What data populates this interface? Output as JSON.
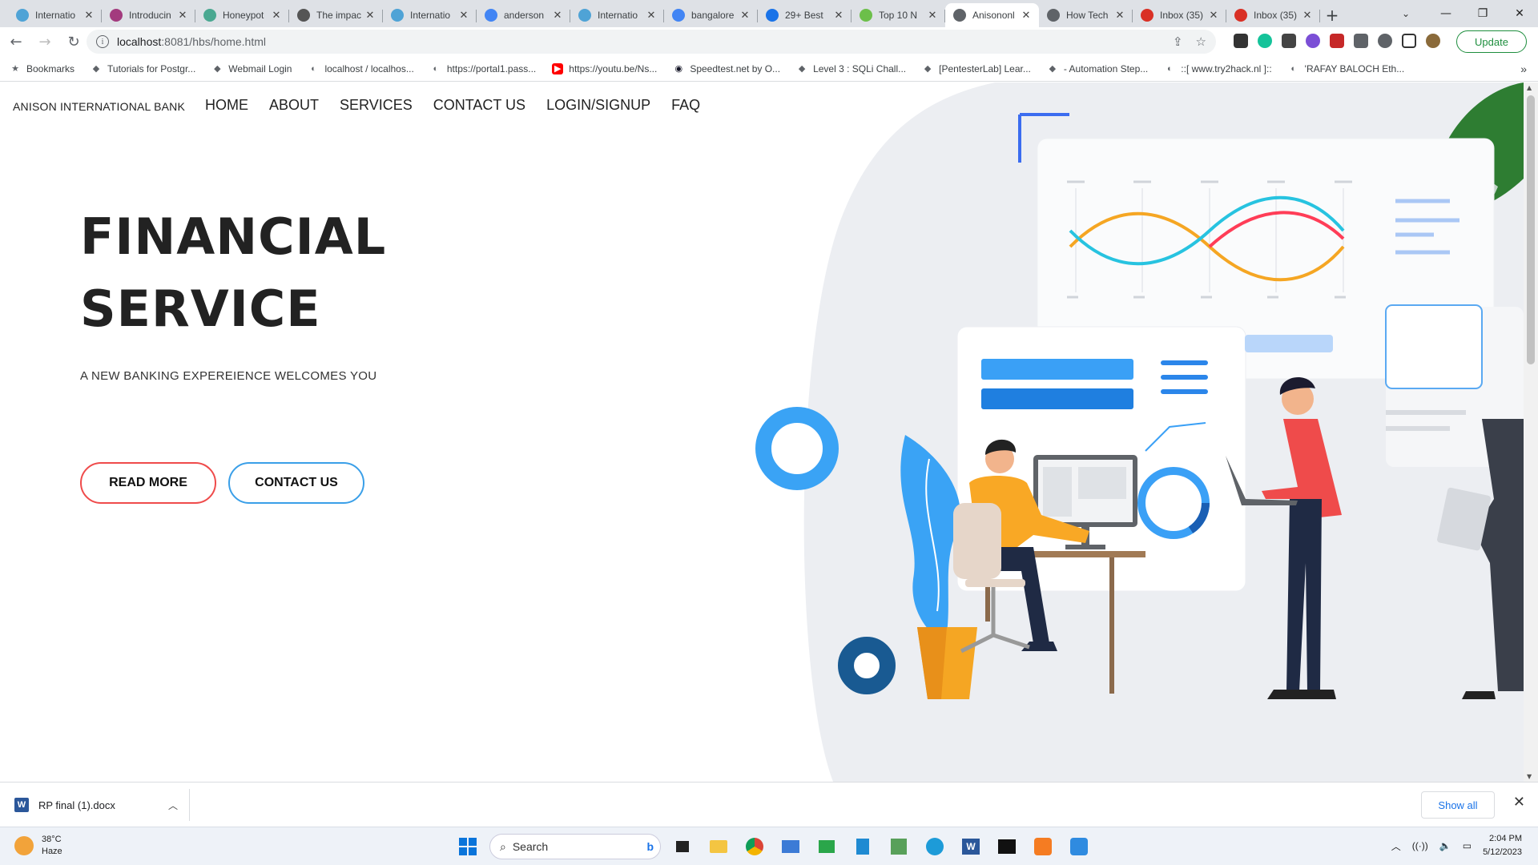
{
  "browser": {
    "tabs": [
      {
        "title": "Internatio",
        "color": "#4fa3d6"
      },
      {
        "title": "Introducin",
        "color": "#a33b7e"
      },
      {
        "title": "Honeypot",
        "color": "#4aa891"
      },
      {
        "title": "The impac",
        "color": "#555555"
      },
      {
        "title": "Internatio",
        "color": "#4fa3d6"
      },
      {
        "title": "anderson",
        "color": "#4285f4"
      },
      {
        "title": "Internatio",
        "color": "#4fa3d6"
      },
      {
        "title": "bangalore",
        "color": "#4285f4"
      },
      {
        "title": "29+ Best",
        "color": "#1a73e8"
      },
      {
        "title": "Top 10 N",
        "color": "#6cbf4a"
      },
      {
        "title": "Anisononl",
        "color": "#5f6368",
        "active": true
      },
      {
        "title": "How Tech",
        "color": "#5f6368"
      },
      {
        "title": "Inbox (35)",
        "color": "#d93025"
      },
      {
        "title": "Inbox (35)",
        "color": "#d93025"
      }
    ],
    "new_tab": "+",
    "close_glyph": "✕",
    "address": {
      "host": "localhost",
      "rest": ":8081/hbs/home.html"
    },
    "update_label": "Update",
    "bookmarks": [
      {
        "label": "Bookmarks",
        "icon": "star-icon"
      },
      {
        "label": "Tutorials for Postgr...",
        "icon": "site-icon"
      },
      {
        "label": "Webmail Login",
        "icon": "site-icon"
      },
      {
        "label": "localhost / localhos...",
        "icon": "globe-icon"
      },
      {
        "label": "https://portal1.pass...",
        "icon": "globe-icon"
      },
      {
        "label": "https://youtu.be/Ns...",
        "icon": "youtube-icon"
      },
      {
        "label": "Speedtest.net by O...",
        "icon": "speedtest-icon"
      },
      {
        "label": "Level 3 : SQLi Chall...",
        "icon": "site-icon"
      },
      {
        "label": "[PentesterLab] Lear...",
        "icon": "site-icon"
      },
      {
        "label": "- Automation Step...",
        "icon": "site-icon"
      },
      {
        "label": "::[ www.try2hack.nl ]::",
        "icon": "globe-icon"
      },
      {
        "label": "'RAFAY BALOCH Eth...",
        "icon": "globe-icon"
      }
    ],
    "bookmarks_more": "»"
  },
  "site": {
    "brand": "ANISON INTERNATIONAL BANK",
    "nav": [
      "HOME",
      "ABOUT",
      "SERVICES",
      "CONTACT US",
      "LOGIN/SIGNUP",
      "FAQ"
    ],
    "hero": {
      "title_line1": "FINANCIAL",
      "title_line2": "SERVICE",
      "subtitle": "A NEW BANKING EXPEREIENCE WELCOMES YOU",
      "read_more": "READ MORE",
      "contact_us": "CONTACT US"
    },
    "accent_colors": {
      "red": "#ef4b4b",
      "blue": "#3a9fe8"
    }
  },
  "downloads": {
    "file": "RP final (1).docx",
    "show_all": "Show all"
  },
  "taskbar": {
    "weather_temp": "38°C",
    "weather_desc": "Haze",
    "search_placeholder": "Search",
    "time": "2:04 PM",
    "date": "5/12/2023"
  }
}
